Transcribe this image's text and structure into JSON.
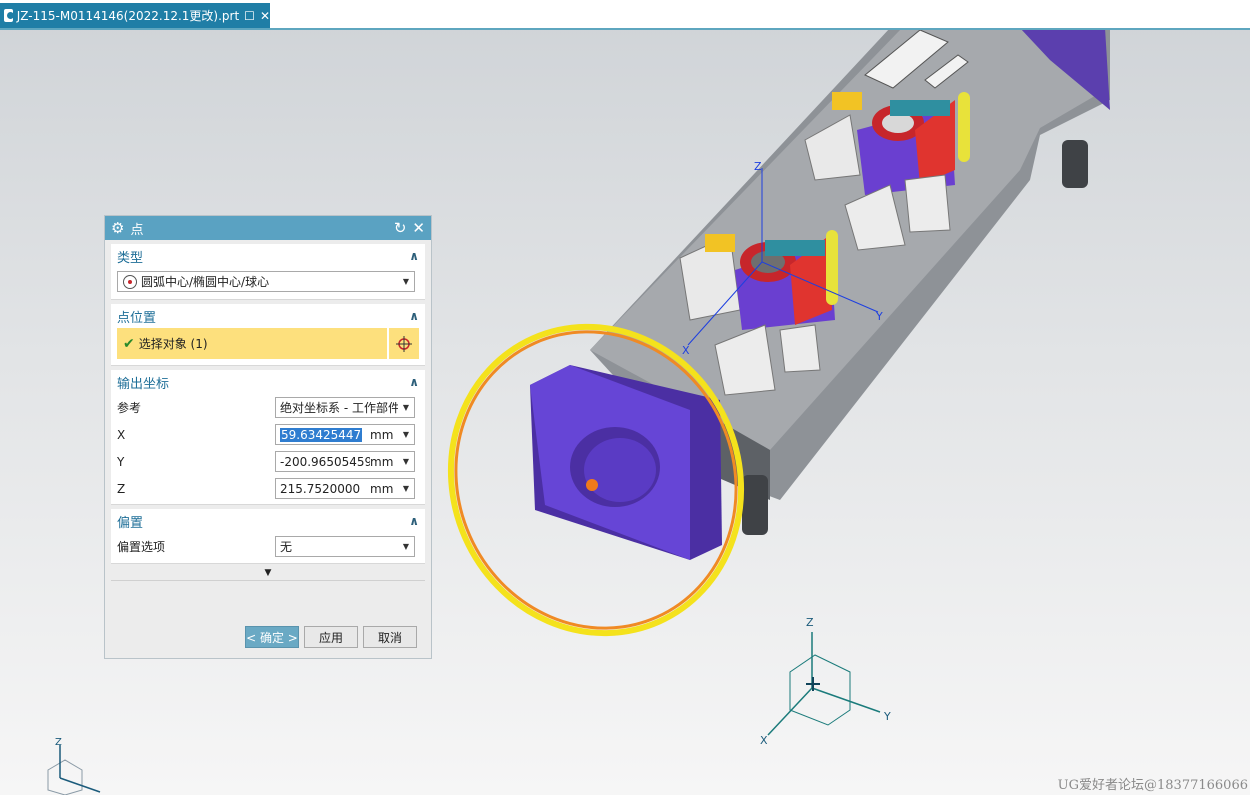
{
  "tab": {
    "title": "JZ-115-M0114146(2022.12.1更改).prt"
  },
  "dialog": {
    "title": "点",
    "type_group": {
      "header": "类型",
      "selected": "圆弧中心/椭圆中心/球心"
    },
    "point_location_group": {
      "header": "点位置",
      "select_label": "选择对象 (1)"
    },
    "output_group": {
      "header": "输出坐标",
      "reference_label": "参考",
      "reference_value": "绝对坐标系 - 工作部件",
      "x_label": "X",
      "x_value": "59.63425447",
      "x_unit": "mm",
      "y_label": "Y",
      "y_value": "-200.96505459",
      "y_unit": "mm",
      "z_label": "Z",
      "z_value": "215.7520000",
      "z_unit": "mm"
    },
    "offset_group": {
      "header": "偏置",
      "option_label": "偏置选项",
      "option_value": "无"
    },
    "buttons": {
      "ok": "< 确定 >",
      "apply": "应用",
      "cancel": "取消"
    }
  },
  "triad": {
    "x": "X",
    "y": "Y",
    "z": "Z"
  },
  "watermark": "UG爱好者论坛@18377166066"
}
